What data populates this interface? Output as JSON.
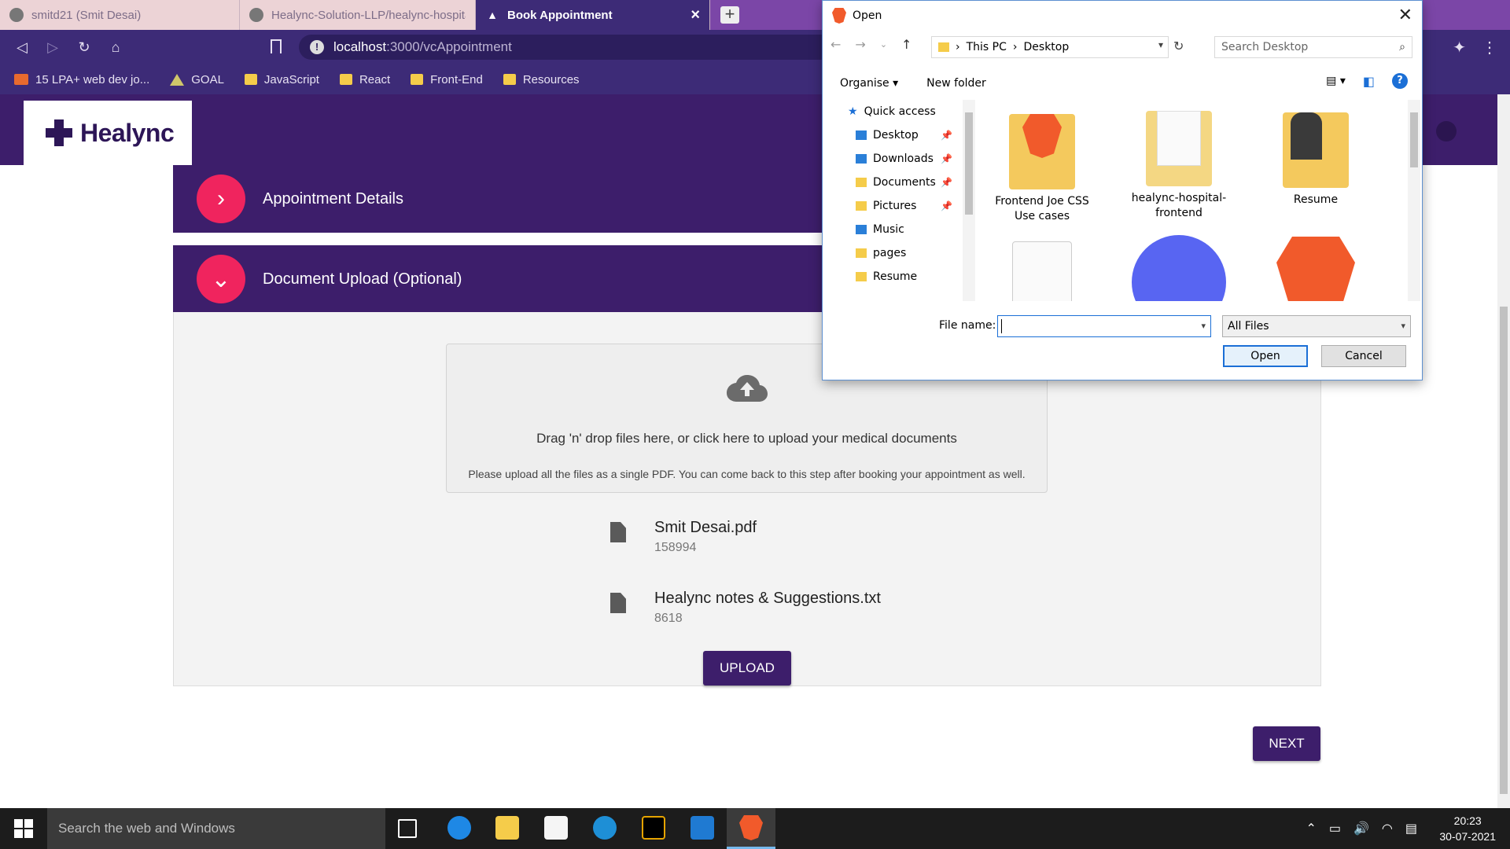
{
  "browser": {
    "tabs": [
      {
        "label": "smitd21 (Smit Desai)"
      },
      {
        "label": "Healync-Solution-LLP/healync-hospita"
      },
      {
        "label": "Book Appointment",
        "active": true
      }
    ],
    "url_host": "localhost",
    "url_path": ":3000/vcAppointment",
    "bookmarks": [
      {
        "label": "15 LPA+ web dev jo..."
      },
      {
        "label": "GOAL"
      },
      {
        "label": "JavaScript"
      },
      {
        "label": "React"
      },
      {
        "label": "Front-End"
      },
      {
        "label": "Resources"
      }
    ]
  },
  "app": {
    "logo": "Healync",
    "sections": [
      {
        "title": "Appointment Details",
        "expanded": false
      },
      {
        "title": "Document Upload (Optional)",
        "expanded": true
      }
    ],
    "dropzone": {
      "main": "Drag 'n' drop files here, or click here to upload your medical documents",
      "sub": "Please upload all the files as a single PDF. You can come back to this step after booking your appointment as well."
    },
    "files": [
      {
        "name": "Smit Desai.pdf",
        "size": "158994"
      },
      {
        "name": "Healync notes & Suggestions.txt",
        "size": "8618"
      }
    ],
    "upload_label": "UPLOAD",
    "next_label": "NEXT"
  },
  "dialog": {
    "title": "Open",
    "path": [
      "This PC",
      "Desktop"
    ],
    "search_placeholder": "Search Desktop",
    "organise": "Organise",
    "new_folder": "New folder",
    "nav": [
      {
        "label": "Quick access",
        "icon": "star-icon"
      },
      {
        "label": "Desktop",
        "pinned": true
      },
      {
        "label": "Downloads",
        "pinned": true
      },
      {
        "label": "Documents",
        "pinned": true
      },
      {
        "label": "Pictures",
        "pinned": true
      },
      {
        "label": "Music"
      },
      {
        "label": "pages"
      },
      {
        "label": "Resume"
      }
    ],
    "tiles": [
      {
        "label": "Frontend Joe CSS Use cases",
        "icon": "brave-folder-icon"
      },
      {
        "label": "healync-hospital-frontend",
        "icon": "folder-icon"
      },
      {
        "label": "Resume",
        "icon": "photo-folder-icon"
      },
      {
        "label": "",
        "icon": "document-icon"
      },
      {
        "label": "",
        "icon": "discord-icon"
      },
      {
        "label": "",
        "icon": "brave-icon"
      }
    ],
    "file_name_label": "File name:",
    "file_name_value": "",
    "file_type": "All Files",
    "open_label": "Open",
    "cancel_label": "Cancel"
  },
  "taskbar": {
    "search_placeholder": "Search the web and Windows",
    "time": "20:23",
    "date": "30-07-2021"
  },
  "colors": {
    "brand_purple": "#3d1e6b",
    "accent_pink": "#f0245e",
    "browser_purple": "#3d2b77"
  }
}
